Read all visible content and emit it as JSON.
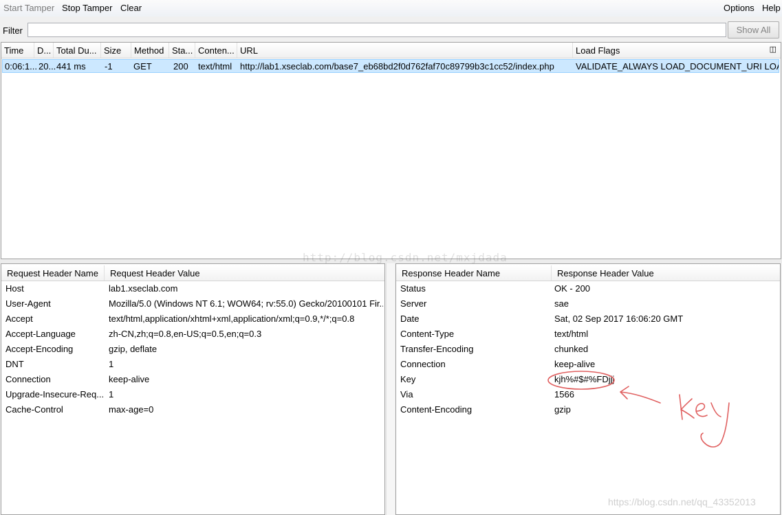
{
  "menubar": {
    "start_tamper": "Start Tamper",
    "stop_tamper": "Stop Tamper",
    "clear": "Clear",
    "options": "Options",
    "help": "Help"
  },
  "filter": {
    "label": "Filter",
    "value": "",
    "show_all": "Show All"
  },
  "request_table": {
    "columns": [
      "Time",
      "D...",
      "Total Du...",
      "Size",
      "Method",
      "Sta...",
      "Conten...",
      "URL",
      "Load Flags"
    ],
    "rows": [
      {
        "time": "0:06:1...",
        "duration": "20...",
        "total_duration": "441 ms",
        "size": "-1",
        "method": "GET",
        "status": "200",
        "content_type": "text/html",
        "url": "http://lab1.xseclab.com/base7_eb68bd2f0d762faf70c89799b3c1cc52/index.php",
        "load_flags": "VALIDATE_ALWAYS LOAD_DOCUMENT_URI  LOA..."
      }
    ]
  },
  "request_headers": {
    "name_col": "Request Header Name",
    "value_col": "Request Header Value",
    "rows": [
      {
        "name": "Host",
        "value": "lab1.xseclab.com"
      },
      {
        "name": "User-Agent",
        "value": "Mozilla/5.0 (Windows NT 6.1; WOW64; rv:55.0) Gecko/20100101 Fir..."
      },
      {
        "name": "Accept",
        "value": "text/html,application/xhtml+xml,application/xml;q=0.9,*/*;q=0.8"
      },
      {
        "name": "Accept-Language",
        "value": "zh-CN,zh;q=0.8,en-US;q=0.5,en;q=0.3"
      },
      {
        "name": "Accept-Encoding",
        "value": "gzip, deflate"
      },
      {
        "name": "DNT",
        "value": "1"
      },
      {
        "name": "Connection",
        "value": "keep-alive"
      },
      {
        "name": "Upgrade-Insecure-Req...",
        "value": "1"
      },
      {
        "name": "Cache-Control",
        "value": "max-age=0"
      }
    ]
  },
  "response_headers": {
    "name_col": "Response Header Name",
    "value_col": "Response Header Value",
    "rows": [
      {
        "name": "Status",
        "value": "OK - 200"
      },
      {
        "name": "Server",
        "value": "sae"
      },
      {
        "name": "Date",
        "value": "Sat, 02 Sep 2017 16:06:20 GMT"
      },
      {
        "name": "Content-Type",
        "value": "text/html"
      },
      {
        "name": "Transfer-Encoding",
        "value": "chunked"
      },
      {
        "name": "Connection",
        "value": "keep-alive"
      },
      {
        "name": "Key",
        "value": "kjh%#$#%FDjjj"
      },
      {
        "name": "Via",
        "value": "1566"
      },
      {
        "name": "Content-Encoding",
        "value": "gzip"
      }
    ]
  },
  "annotation": {
    "handwritten_text": "key",
    "color": "#e06060"
  },
  "watermarks": {
    "center": "http://blog.csdn.net/mxjdada",
    "bottom_right": "https://blog.csdn.net/qq_43352013"
  },
  "colors": {
    "selected_row_bg": "#cce8ff",
    "selected_row_border": "#99d1ff",
    "annotation": "#e06060"
  }
}
